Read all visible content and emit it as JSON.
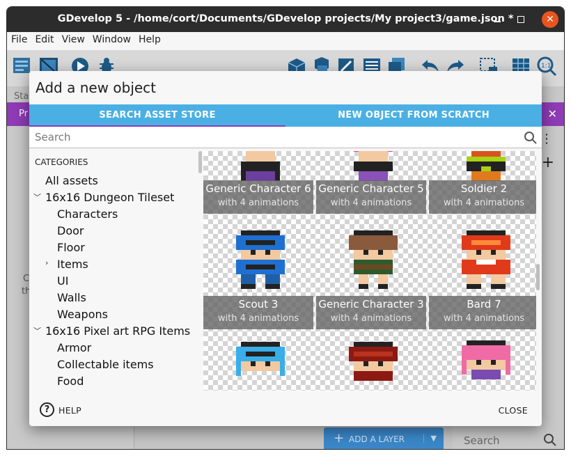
{
  "window": {
    "title": "GDevelop 5 - /home/cort/Documents/GDevelop projects/My project3/game.json *",
    "min_icon": "minimize-icon",
    "max_icon": "maximize-icon",
    "close_icon": "close-icon"
  },
  "menubar": {
    "items": [
      "File",
      "Edit",
      "View",
      "Window",
      "Help"
    ]
  },
  "background": {
    "status_prefix": "Sta",
    "tab_prefix": "Pr",
    "left_text_1": "C",
    "left_text_2": "th",
    "add_layer_label": "ADD A LAYER",
    "search_placeholder": "Search"
  },
  "dialog": {
    "title": "Add a new object",
    "tabs": [
      "SEARCH ASSET STORE",
      "NEW OBJECT FROM SCRATCH"
    ],
    "active_tab": 0,
    "search": {
      "placeholder": "Search",
      "value": ""
    },
    "categories_header": "CATEGORIES",
    "categories": [
      {
        "label": "All assets",
        "level": 0
      },
      {
        "label": "16x16 Dungeon Tileset",
        "level": 0,
        "expanded": true
      },
      {
        "label": "Characters",
        "level": 1
      },
      {
        "label": "Door",
        "level": 1
      },
      {
        "label": "Floor",
        "level": 1
      },
      {
        "label": "Items",
        "level": 1,
        "collapsed": true
      },
      {
        "label": "UI",
        "level": 1
      },
      {
        "label": "Walls",
        "level": 1
      },
      {
        "label": "Weapons",
        "level": 1
      },
      {
        "label": "16x16 Pixel art RPG Items",
        "level": 0,
        "expanded": true
      },
      {
        "label": "Armor",
        "level": 1
      },
      {
        "label": "Collectable items",
        "level": 1
      },
      {
        "label": "Food",
        "level": 1
      }
    ],
    "assets": [
      {
        "name": "Generic Character 6",
        "sub": "with 4 animations"
      },
      {
        "name": "Generic Character 5",
        "sub": "with 4 animations"
      },
      {
        "name": "Soldier 2",
        "sub": "with 4 animations"
      },
      {
        "name": "Scout 3",
        "sub": "with 4 animations"
      },
      {
        "name": "Generic Character 3",
        "sub": "with 4 animations"
      },
      {
        "name": "Bard 7",
        "sub": "with 4 animations"
      }
    ],
    "help_label": "HELP",
    "close_label": "CLOSE"
  },
  "colors": {
    "accent_blue": "#4ab0e4",
    "accent_purple": "#8f3bb6",
    "close_button": "#e95420"
  }
}
